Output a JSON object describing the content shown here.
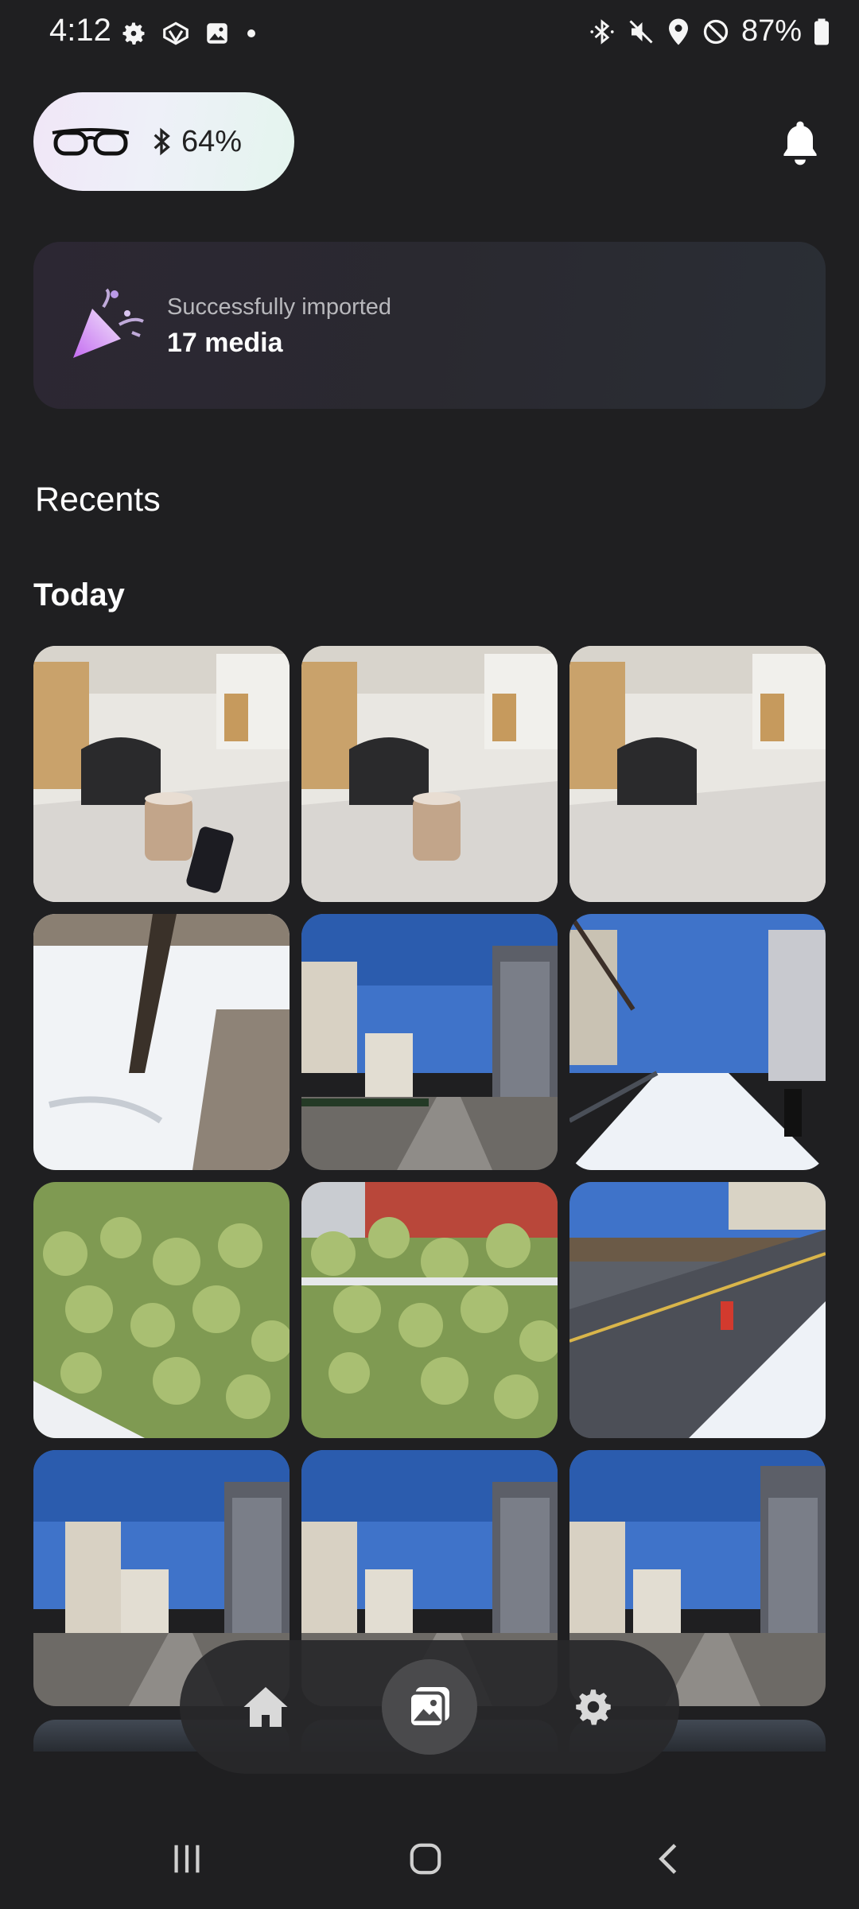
{
  "status_bar": {
    "time": "4:12",
    "battery": "87%",
    "left_icons": [
      "settings-icon",
      "meta-icon",
      "gallery-icon",
      "dot-icon"
    ],
    "right_icons": [
      "bluetooth-icon",
      "mute-icon",
      "location-icon",
      "dnd-icon",
      "battery-icon"
    ]
  },
  "device": {
    "icon": "glasses-icon",
    "battery": "64%"
  },
  "banner": {
    "line1": "Successfully imported",
    "line2": "17 media",
    "icon": "party-popper-icon"
  },
  "recents_title": "Recents",
  "day_title": "Today",
  "photos": [
    {
      "kind": "cafe",
      "variant": 1
    },
    {
      "kind": "cafe",
      "variant": 2
    },
    {
      "kind": "cafe",
      "variant": 3
    },
    {
      "kind": "snow-tree",
      "variant": 1
    },
    {
      "kind": "street",
      "variant": 1
    },
    {
      "kind": "snow-path",
      "variant": 1
    },
    {
      "kind": "hedge",
      "variant": 1
    },
    {
      "kind": "hedge",
      "variant": 2
    },
    {
      "kind": "road",
      "variant": 1
    },
    {
      "kind": "street",
      "variant": 2
    },
    {
      "kind": "street",
      "variant": 3
    },
    {
      "kind": "street",
      "variant": 4
    }
  ],
  "tabs": [
    {
      "name": "home",
      "icon": "home-icon",
      "active": false
    },
    {
      "name": "gallery",
      "icon": "gallery-icon",
      "active": true
    },
    {
      "name": "settings",
      "icon": "gear-icon",
      "active": false
    }
  ],
  "nav": [
    "recents-icon",
    "home-icon",
    "back-icon"
  ],
  "colors": {
    "background": "#1f1f21",
    "tab_active": "#4a4a4c"
  }
}
